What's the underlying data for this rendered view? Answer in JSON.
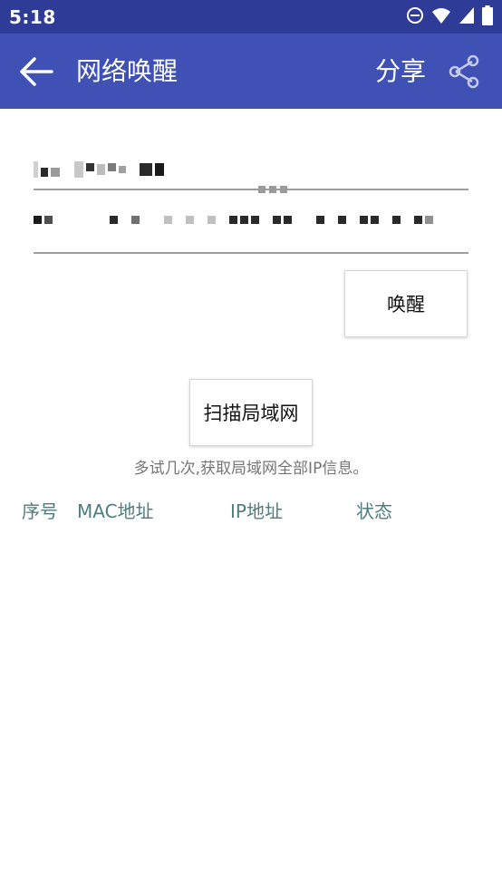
{
  "status_bar": {
    "time": "5:18",
    "icons": [
      "do-not-disturb-icon",
      "wifi-icon",
      "signal-icon",
      "battery-icon"
    ]
  },
  "app_bar": {
    "title": "网络唤醒",
    "share_label": "分享",
    "back_icon": "arrow-back-icon",
    "share_icon": "share-icon",
    "color": "#3f51b5",
    "status_color": "#2e3b97"
  },
  "form": {
    "ip_field_value": "",
    "mac_field_value": ""
  },
  "buttons": {
    "wake_label": "唤醒",
    "scan_label": "扫描局域网"
  },
  "hint": "多试几次,获取局域网全部IP信息。",
  "table": {
    "headers": [
      "序号",
      "MAC地址",
      "IP地址",
      "状态"
    ],
    "header_color": "#4e7d7d",
    "rows": []
  }
}
